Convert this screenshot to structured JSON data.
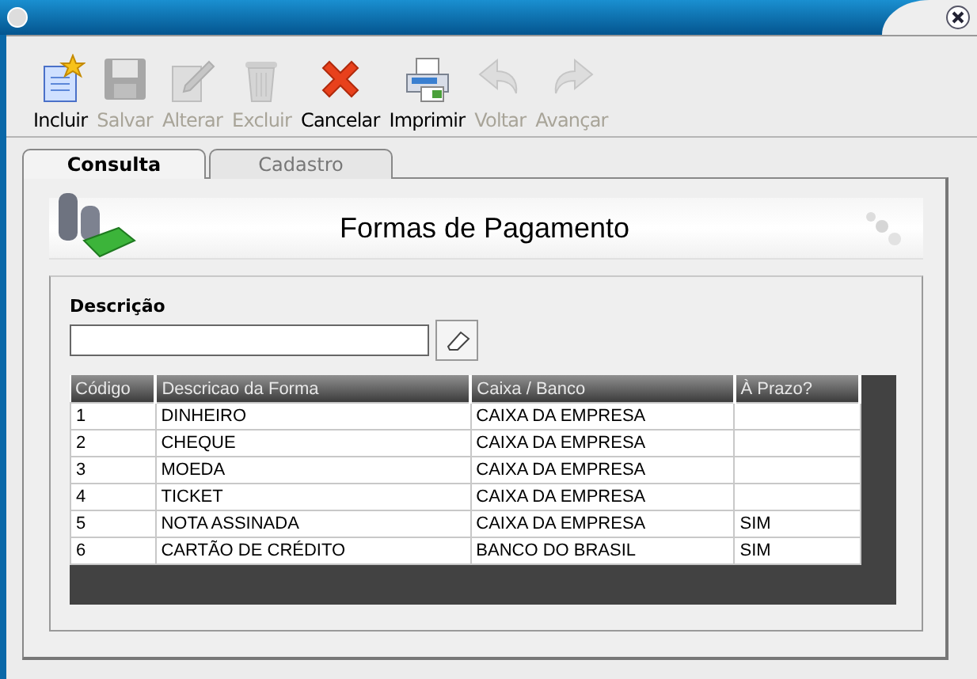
{
  "toolbar": [
    {
      "kind": "new",
      "label": "Incluir",
      "disabled": false
    },
    {
      "kind": "save",
      "label": "Salvar",
      "disabled": true
    },
    {
      "kind": "edit",
      "label": "Alterar",
      "disabled": true
    },
    {
      "kind": "delete",
      "label": "Excluir",
      "disabled": true
    },
    {
      "kind": "cancel",
      "label": "Cancelar",
      "disabled": false
    },
    {
      "kind": "print",
      "label": "Imprimir",
      "disabled": false
    },
    {
      "kind": "back",
      "label": "Voltar",
      "disabled": true
    },
    {
      "kind": "forward",
      "label": "Avançar",
      "disabled": true
    }
  ],
  "tabs": [
    {
      "label": "Consulta",
      "selected": true
    },
    {
      "label": "Cadastro",
      "selected": false
    }
  ],
  "header": {
    "title": "Formas de Pagamento"
  },
  "search": {
    "label": "Descrição"
  },
  "table": {
    "columns": [
      "Código",
      "Descricao da Forma",
      "Caixa / Banco",
      "À Prazo?"
    ],
    "rows": [
      [
        "1",
        "DINHEIRO",
        "CAIXA DA EMPRESA",
        ""
      ],
      [
        "2",
        "CHEQUE",
        "CAIXA DA EMPRESA",
        ""
      ],
      [
        "3",
        "MOEDA",
        "CAIXA DA EMPRESA",
        ""
      ],
      [
        "4",
        "TICKET",
        "CAIXA DA EMPRESA",
        ""
      ],
      [
        "5",
        "NOTA ASSINADA",
        "CAIXA DA EMPRESA",
        "SIM"
      ],
      [
        "6",
        "CARTÃO DE CRÉDITO",
        "BANCO DO BRASIL",
        "SIM"
      ]
    ]
  }
}
